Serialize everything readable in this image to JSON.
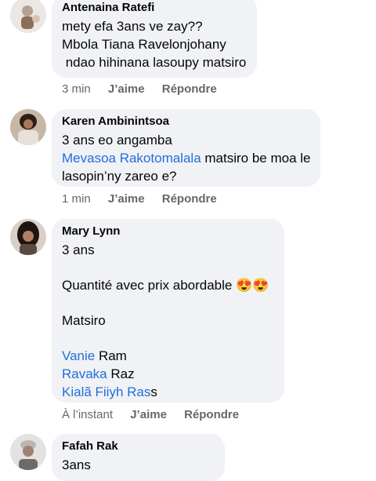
{
  "comments": [
    {
      "author": "Antenaina Ratefi",
      "lines": [
        "mety efa 3ans ve zay??",
        "Mbola Tiana Ravelonjohany",
        " ndao hihinana lasoupy matsiro"
      ],
      "time": "3 min",
      "like": "J’aime",
      "reply": "Répondre"
    },
    {
      "author": "Karen Ambinintsoa",
      "line1": "3 ans eo angamba",
      "mention": "Mevasoa Rakotomalala",
      "line2_rest": " matsiro be moa le",
      "line3": "lasopin’ny zareo e?",
      "time": "1 min",
      "like": "J’aime",
      "reply": "Répondre"
    },
    {
      "author": "Mary Lynn",
      "line1": "3 ans",
      "line2": "Quantité avec prix abordable ",
      "emoji": "😍😍",
      "line3": "Matsiro",
      "tag1_mention": "Vanie",
      "tag1_rest": " Ram",
      "tag2_mention": "Ravaka",
      "tag2_rest": " Raz",
      "tag3_mention": "Kialã Fiiyh Ras",
      "tag3_rest": "s",
      "time": "À l’instant",
      "like": "J’aime",
      "reply": "Répondre"
    },
    {
      "author": "Fafah Rak",
      "line1": "3ans"
    }
  ],
  "colors": {
    "bubble": "#f0f2f5",
    "mention": "#216fdb",
    "meta": "#65676b"
  }
}
